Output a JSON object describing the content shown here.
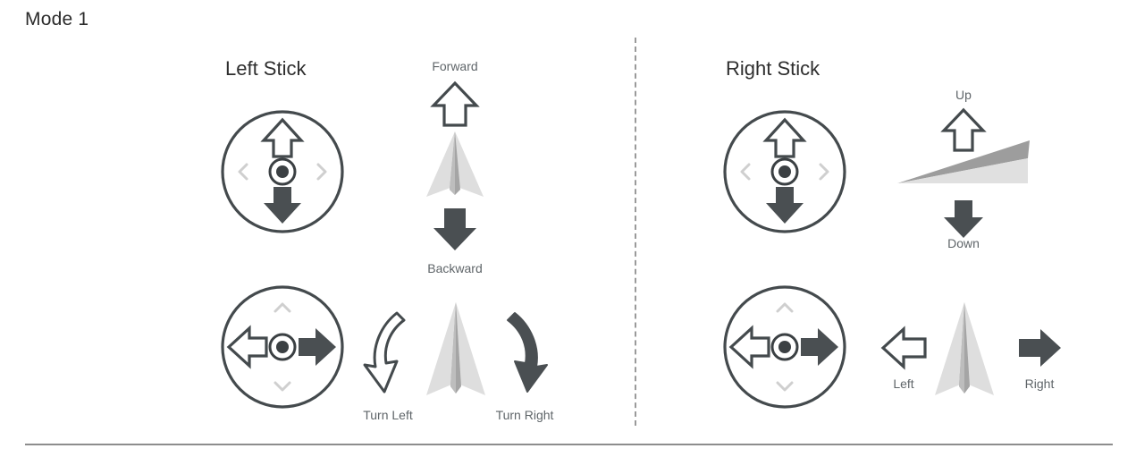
{
  "title": "Mode 1",
  "panels": {
    "left": {
      "heading": "Left Stick",
      "pitch": {
        "forward_label": "Forward",
        "backward_label": "Backward",
        "stick_icon": "stick-vertical-icon",
        "aircraft_icon": "aircraft-top-view-icon",
        "up_arrow_icon": "arrow-up-outline-icon",
        "down_arrow_icon": "arrow-down-filled-icon"
      },
      "yaw": {
        "turn_left_label": "Turn Left",
        "turn_right_label": "Turn Right",
        "stick_icon": "stick-horizontal-icon",
        "aircraft_icon": "aircraft-top-view-icon",
        "turn_left_icon": "curved-arrow-left-outline-icon",
        "turn_right_icon": "curved-arrow-right-filled-icon"
      }
    },
    "right": {
      "heading": "Right Stick",
      "throttle": {
        "up_label": "Up",
        "down_label": "Down",
        "stick_icon": "stick-vertical-icon",
        "aircraft_icon": "aircraft-side-view-icon",
        "up_arrow_icon": "arrow-up-outline-icon",
        "down_arrow_icon": "arrow-down-filled-icon"
      },
      "roll": {
        "left_label": "Left",
        "right_label": "Right",
        "stick_icon": "stick-horizontal-icon",
        "aircraft_icon": "aircraft-top-view-icon",
        "left_arrow_icon": "arrow-left-outline-icon",
        "right_arrow_icon": "arrow-right-filled-icon"
      }
    }
  },
  "colors": {
    "stroke_dark": "#444a4d",
    "fill_dark": "#4a4f52",
    "aircraft_light": "#dedede",
    "aircraft_mid": "#9d9d9d",
    "chevron_faint": "#cfcfcf",
    "caption_text": "#5f6569",
    "title_text": "#2b2b2b",
    "divider": "#9a9a9a",
    "rule": "#8d8d8d",
    "background": "#ffffff"
  }
}
